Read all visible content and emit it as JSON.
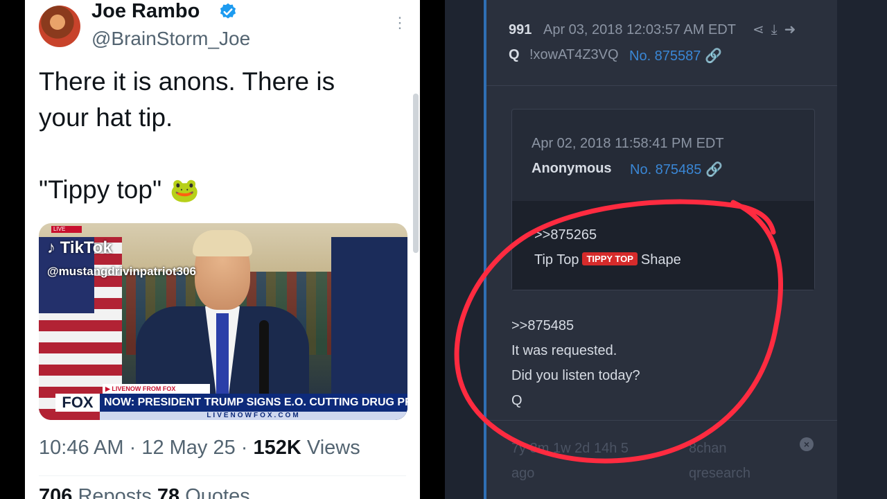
{
  "tweet": {
    "author_name": "Joe Rambo",
    "handle": "@BrainStorm_Joe",
    "more_label": "⋮",
    "text_line1": "There it is anons.  There is",
    "text_line2": "your hat tip.",
    "text_quote": "\"Tippy top\"",
    "emoji": "🐸",
    "video": {
      "live_tag": "LIVE",
      "tiktok_brand": "TikTok",
      "tiktok_user": "@mustangdrivinpatriot306",
      "lower_third_top": "▶ LIVENOW FROM FOX",
      "network": "FOX",
      "headline": "NOW: PRESIDENT TRUMP SIGNS E.O. CUTTING DRUG PRICES",
      "url": "LIVENOWFOX.COM"
    },
    "time": "10:46 AM",
    "date": "12 May 25",
    "views_count": "152K",
    "views_label": "Views",
    "reposts_count": "706",
    "reposts_label": "Reposts",
    "quotes_count": "78",
    "quotes_label": "Quotes"
  },
  "qdrop": {
    "post_number": "991",
    "post_date": "Apr 03, 2018 12:03:57 AM EDT",
    "poster_name": "Q",
    "tripcode": "!xowAT4Z3VQ",
    "post_id": "No. 875587",
    "quoted": {
      "date": "Apr 02, 2018 11:58:41 PM EDT",
      "author": "Anonymous",
      "post_id": "No. 875485",
      "reply_ref": ">>875265",
      "line_before": "Tip Top",
      "badge": "TIPPY TOP",
      "line_after": "Shape"
    },
    "body_lines": [
      ">>875485",
      "It was requested.",
      "Did you listen today?",
      "Q"
    ],
    "footer_left_1": "7y 3m 1w 2d 14h 5",
    "footer_left_2": "ago",
    "footer_right_1": "8chan",
    "footer_right_2": "qresearch"
  },
  "colors": {
    "twitter_verified": "#1d9bf0",
    "q_link": "#3a87d6",
    "q_badge": "#d62b2b",
    "annotation_circle": "#ff2b40",
    "q_panel_bg": "#1e2430"
  }
}
